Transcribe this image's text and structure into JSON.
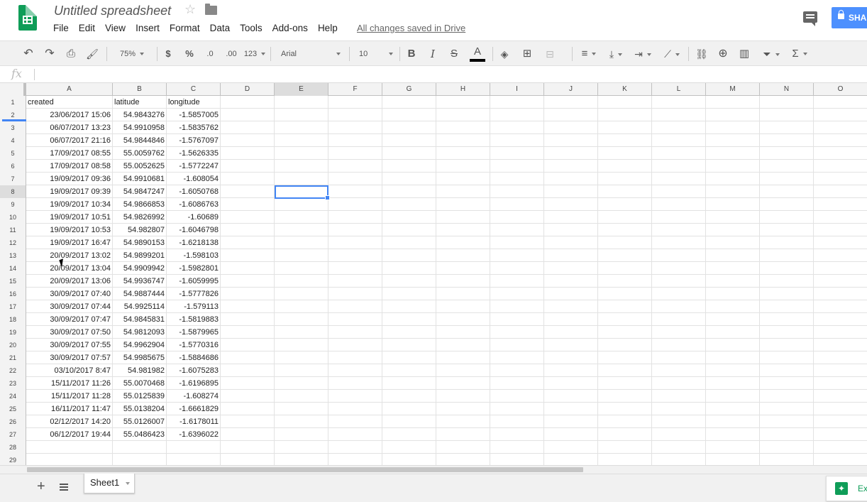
{
  "title_bar": {
    "doc_title": "Untitled spreadsheet",
    "save_status": "All changes saved in Drive",
    "share_label": "SHA"
  },
  "menu": [
    "File",
    "Edit",
    "View",
    "Insert",
    "Format",
    "Data",
    "Tools",
    "Add-ons",
    "Help"
  ],
  "toolbar": {
    "zoom": "75%",
    "currency": "$",
    "percent": "%",
    "decrease_decimals": ".0",
    "increase_decimals": ".00",
    "more_formats": "123",
    "font": "Arial",
    "font_size": "10",
    "bold": "B",
    "italic": "I",
    "strikethrough": "S",
    "text_color": "A"
  },
  "formula_bar": {
    "fx": "fx",
    "value": ""
  },
  "grid": {
    "columns": [
      "A",
      "B",
      "C",
      "D",
      "E",
      "F",
      "G",
      "H",
      "I",
      "J",
      "K",
      "L",
      "M",
      "N",
      "O"
    ],
    "active_column": "E",
    "active_row": "8",
    "rows": [
      {
        "num": "1",
        "a": "created",
        "b": "latitude",
        "c": "longitude"
      },
      {
        "num": "2",
        "a": "23/06/2017 15:06",
        "b": "54.9843276",
        "c": "-1.5857005"
      },
      {
        "num": "3",
        "a": "06/07/2017 13:23",
        "b": "54.9910958",
        "c": "-1.5835762"
      },
      {
        "num": "4",
        "a": "06/07/2017 21:16",
        "b": "54.9844846",
        "c": "-1.5767097"
      },
      {
        "num": "5",
        "a": "17/09/2017 08:55",
        "b": "55.0059762",
        "c": "-1.5626335"
      },
      {
        "num": "6",
        "a": "17/09/2017 08:58",
        "b": "55.0052625",
        "c": "-1.5772247"
      },
      {
        "num": "7",
        "a": "19/09/2017 09:36",
        "b": "54.9910681",
        "c": "-1.608054"
      },
      {
        "num": "8",
        "a": "19/09/2017 09:39",
        "b": "54.9847247",
        "c": "-1.6050768"
      },
      {
        "num": "9",
        "a": "19/09/2017 10:34",
        "b": "54.9866853",
        "c": "-1.6086763"
      },
      {
        "num": "10",
        "a": "19/09/2017 10:51",
        "b": "54.9826992",
        "c": "-1.60689"
      },
      {
        "num": "11",
        "a": "19/09/2017 10:53",
        "b": "54.982807",
        "c": "-1.6046798"
      },
      {
        "num": "12",
        "a": "19/09/2017 16:47",
        "b": "54.9890153",
        "c": "-1.6218138"
      },
      {
        "num": "13",
        "a": "20/09/2017 13:02",
        "b": "54.9899201",
        "c": "-1.598103"
      },
      {
        "num": "14",
        "a": "20/09/2017 13:04",
        "b": "54.9909942",
        "c": "-1.5982801"
      },
      {
        "num": "15",
        "a": "20/09/2017 13:06",
        "b": "54.9936747",
        "c": "-1.6059995"
      },
      {
        "num": "16",
        "a": "30/09/2017 07:40",
        "b": "54.9887444",
        "c": "-1.5777826"
      },
      {
        "num": "17",
        "a": "30/09/2017 07:44",
        "b": "54.9925114",
        "c": "-1.579113"
      },
      {
        "num": "18",
        "a": "30/09/2017 07:47",
        "b": "54.9845831",
        "c": "-1.5819883"
      },
      {
        "num": "19",
        "a": "30/09/2017 07:50",
        "b": "54.9812093",
        "c": "-1.5879965"
      },
      {
        "num": "20",
        "a": "30/09/2017 07:55",
        "b": "54.9962904",
        "c": "-1.5770316"
      },
      {
        "num": "21",
        "a": "30/09/2017 07:57",
        "b": "54.9985675",
        "c": "-1.5884686"
      },
      {
        "num": "22",
        "a": "03/10/2017 8:47",
        "b": "54.981982",
        "c": "-1.6075283"
      },
      {
        "num": "23",
        "a": "15/11/2017 11:26",
        "b": "55.0070468",
        "c": "-1.6196895"
      },
      {
        "num": "24",
        "a": "15/11/2017 11:28",
        "b": "55.0125839",
        "c": "-1.608274"
      },
      {
        "num": "25",
        "a": "16/11/2017 11:47",
        "b": "55.0138204",
        "c": "-1.6661829"
      },
      {
        "num": "26",
        "a": "02/12/2017 14:20",
        "b": "55.0126007",
        "c": "-1.6178011"
      },
      {
        "num": "27",
        "a": "06/12/2017 19:44",
        "b": "55.0486423",
        "c": "-1.6396022"
      },
      {
        "num": "28",
        "a": "",
        "b": "",
        "c": ""
      },
      {
        "num": "29",
        "a": "",
        "b": "",
        "c": ""
      }
    ]
  },
  "bottom_bar": {
    "add_sheet": "+",
    "sheet_tab": "Sheet1",
    "explore_label": "Ex"
  },
  "colors": {
    "sheets_green": "#0f9d58",
    "selection_blue": "#4285f4",
    "share_blue": "#4d90fe"
  }
}
